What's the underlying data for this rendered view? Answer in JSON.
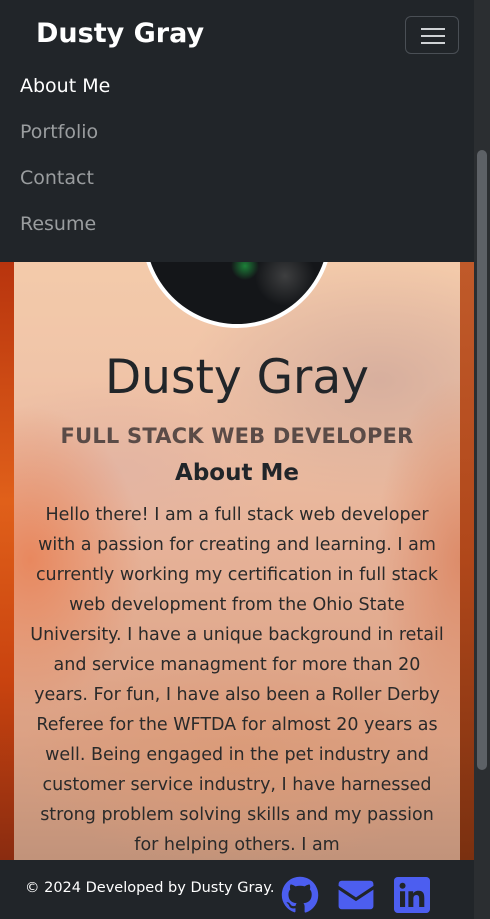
{
  "navbar": {
    "brand": "Dusty Gray",
    "items": [
      {
        "label": "About Me",
        "active": true
      },
      {
        "label": "Portfolio",
        "active": false
      },
      {
        "label": "Contact",
        "active": false
      },
      {
        "label": "Resume",
        "active": false
      }
    ],
    "toggler_icon": "hamburger-icon"
  },
  "hero": {
    "name": "Dusty Gray",
    "role": "FULL STACK WEB DEVELOPER"
  },
  "about": {
    "heading": "About Me",
    "text": "Hello there! I am a full stack web developer with a passion for creating and learning. I am currently working my certification in full stack web development from the Ohio State University. I have a unique background in retail and service managment for more than 20 years. For fun, I have also been a Roller Derby Referee for the WFTDA for almost 20 years as well. Being engaged in the pet industry and customer service industry, I have harnessed strong problem solving skills and my passion for helping others. I am"
  },
  "footer": {
    "copyright": "© 2024 Developed by Dusty Gray.",
    "icons": [
      "github-icon",
      "envelope-icon",
      "linkedin-icon"
    ],
    "icon_color": "#4c5ef0"
  },
  "colors": {
    "navbar_bg": "#212529",
    "active_link": "#ffffff",
    "inactive_link": "#9a9d9f"
  }
}
